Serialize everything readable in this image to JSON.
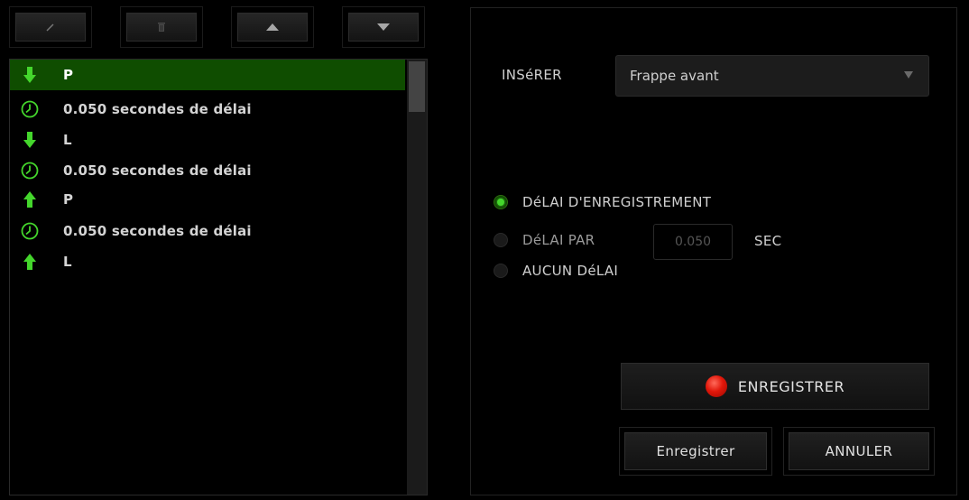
{
  "toolbar": {
    "buttons": [
      {
        "icon": "pencil-icon"
      },
      {
        "icon": "trash-icon"
      },
      {
        "icon": "arrow-up-icon"
      },
      {
        "icon": "arrow-down-icon"
      }
    ]
  },
  "macro_list": {
    "items": [
      {
        "icon": "key-down-arrow-icon",
        "text": "P",
        "selected": true
      },
      {
        "icon": "clock-icon",
        "text": "0.050 secondes de délai",
        "selected": false
      },
      {
        "icon": "key-down-arrow-icon",
        "text": "L",
        "selected": false
      },
      {
        "icon": "clock-icon",
        "text": "0.050 secondes de délai",
        "selected": false
      },
      {
        "icon": "key-up-arrow-icon",
        "text": "P",
        "selected": false
      },
      {
        "icon": "clock-icon",
        "text": "0.050 secondes de délai",
        "selected": false
      },
      {
        "icon": "key-up-arrow-icon",
        "text": "L",
        "selected": false
      }
    ]
  },
  "insert": {
    "label": "INSéRER",
    "selected_option": "Frappe avant"
  },
  "delay_options": {
    "record_delay": "DéLAI D'ENREGISTREMENT",
    "default_delay": "DéLAI PAR",
    "default_delay_value": "0.050",
    "default_delay_unit": "SEC",
    "no_delay": "AUCUN DéLAI",
    "selected": "record_delay"
  },
  "actions": {
    "record": "ENREGISTRER",
    "save": "Enregistrer",
    "cancel": "ANNULER"
  },
  "colors": {
    "accent_green": "#44d62c",
    "selection_green": "#0f4d00",
    "record_red": "#e1170a",
    "background": "#000000"
  }
}
